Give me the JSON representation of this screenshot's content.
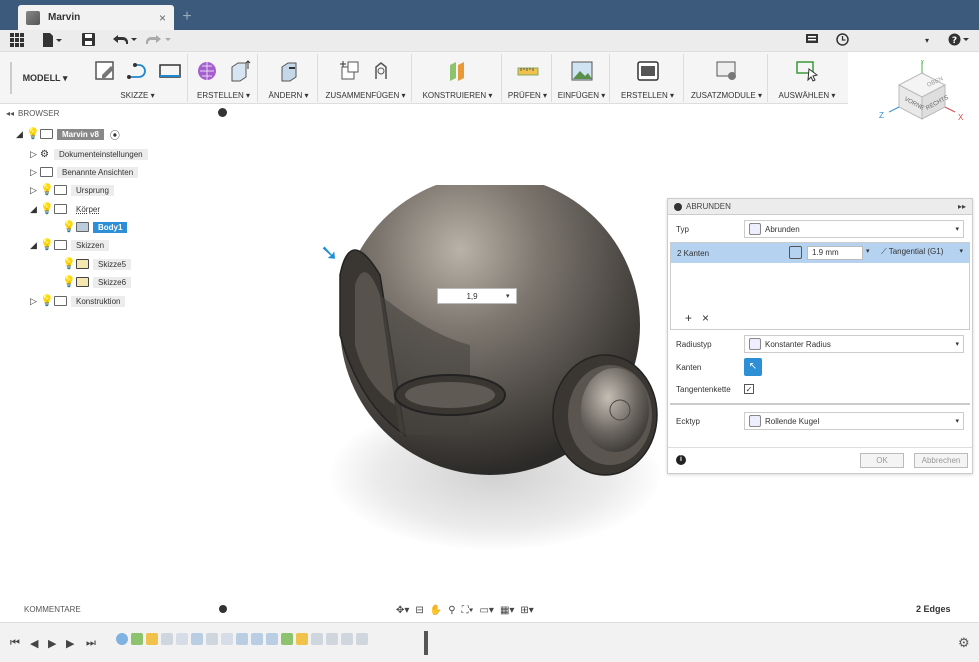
{
  "app": {
    "tab_title": "Marvin",
    "tab_close": "×",
    "new_tab": "+"
  },
  "quick_access": {
    "icons": [
      "grid-icon",
      "file-icon",
      "save-icon",
      "undo-icon",
      "redo-icon",
      "chat-icon",
      "clock-icon",
      "help-icon"
    ]
  },
  "ribbon": {
    "workspace": "MODELL ▾",
    "groups": [
      {
        "label": "SKIZZE ▾"
      },
      {
        "label": "ERSTELLEN ▾"
      },
      {
        "label": "ÄNDERN ▾"
      },
      {
        "label": "ZUSAMMENFÜGEN ▾"
      },
      {
        "label": "KONSTRUIEREN ▾"
      },
      {
        "label": "PRÜFEN ▾"
      },
      {
        "label": "EINFÜGEN ▾"
      },
      {
        "label": "ERSTELLEN ▾"
      },
      {
        "label": "ZUSATZMODULE ▾"
      },
      {
        "label": "AUSWÄHLEN ▾"
      }
    ]
  },
  "viewcube": {
    "top": "OBEN",
    "front": "VORNE",
    "right": "RECHTS",
    "axis_x": "X",
    "axis_y": "Y",
    "axis_z": "Z"
  },
  "browser": {
    "title": "BROWSER",
    "collapse": "◂◂",
    "items": [
      {
        "label": "Marvin v8"
      },
      {
        "label": "Dokumenteinstellungen"
      },
      {
        "label": "Benannte Ansichten"
      },
      {
        "label": "Ursprung"
      },
      {
        "label": "Körper"
      },
      {
        "label": "Body1"
      },
      {
        "label": "Skizzen"
      },
      {
        "label": "Skizze5"
      },
      {
        "label": "Skizze6"
      },
      {
        "label": "Konstruktion"
      }
    ]
  },
  "canvas": {
    "dimension_value": "1,9"
  },
  "dialog": {
    "title": "ABRUNDEN",
    "expand": "▸▸",
    "typ_label": "Typ",
    "typ_value": "Abrunden",
    "edges_label": "2 Kanten",
    "radius_value": "1.9 mm",
    "tangent_value": "Tangential (G1)",
    "add": "+",
    "remove": "×",
    "radiustyp_label": "Radiustyp",
    "radiustyp_value": "Konstanter Radius",
    "kanten_label": "Kanten",
    "tangentenkette_label": "Tangentenkette",
    "tangentenkette_checked": "✓",
    "ecktyp_label": "Ecktyp",
    "ecktyp_value": "Rollende Kugel",
    "info": "i",
    "ok": "OK",
    "cancel": "Abbrechen"
  },
  "comments": {
    "title": "KOMMENTARE"
  },
  "status": {
    "selection": "2 Edges"
  },
  "timeline": {
    "first": "⏮",
    "prev": "◀",
    "play": "▶",
    "next": "▶",
    "last": "⏭",
    "settings": "⚙"
  }
}
